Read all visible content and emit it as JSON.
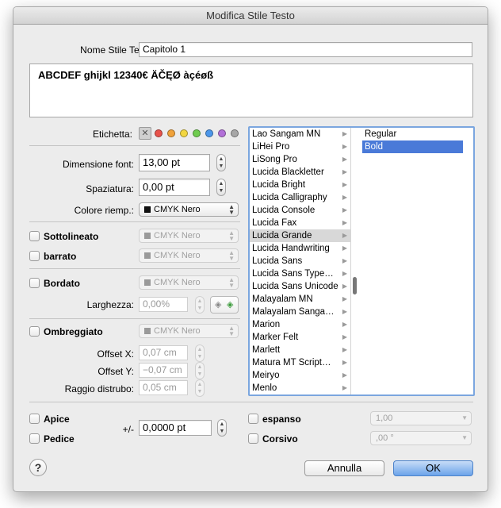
{
  "window": {
    "title": "Modifica Stile Testo"
  },
  "style_name": {
    "label": "Nome Stile Testo:",
    "value": "Capitolo 1"
  },
  "preview": {
    "text": "ABCDEF ghijkl 12340€ ÄČĘØ àçéøß"
  },
  "label_row": {
    "label": "Etichetta:",
    "none_symbol": "✕",
    "colors": [
      "#e8524b",
      "#f0a23a",
      "#f2d641",
      "#6fcc4f",
      "#4c97ea",
      "#b270d8",
      "#a7a7a7"
    ]
  },
  "font_size": {
    "label": "Dimensione font:",
    "value": "13,00 pt"
  },
  "spacing": {
    "label": "Spaziatura:",
    "value": "0,00 pt"
  },
  "fill_color": {
    "label": "Colore riemp.:",
    "value": "CMYK Nero"
  },
  "underline": {
    "label": "Sottolineato",
    "color": "CMYK Nero"
  },
  "strikethrough": {
    "label": "barrato",
    "color": "CMYK Nero"
  },
  "outline": {
    "label": "Bordato",
    "color": "CMYK Nero",
    "width_label": "Larghezza:",
    "width_value": "0,00%"
  },
  "shadow": {
    "label": "Ombreggiato",
    "color": "CMYK Nero",
    "offset_x_label": "Offset X:",
    "offset_x": "0,07 cm",
    "offset_y_label": "Offset Y:",
    "offset_y": "−0,07 cm",
    "blur_label": "Raggio distrubo:",
    "blur": "0,05 cm"
  },
  "fonts": {
    "families": [
      "Lao Sangam MN",
      "LiHei Pro",
      "LiSong Pro",
      "Lucida Blackletter",
      "Lucida Bright",
      "Lucida Calligraphy",
      "Lucida Console",
      "Lucida Fax",
      "Lucida Grande",
      "Lucida Handwriting",
      "Lucida Sans",
      "Lucida Sans Type…",
      "Lucida Sans Unicode",
      "Malayalam MN",
      "Malayalam Sanga…",
      "Marion",
      "Marker Felt",
      "Marlett",
      "Matura MT Script…",
      "Meiryo",
      "Menlo"
    ],
    "selected_family": "Lucida Grande",
    "styles": [
      "Regular",
      "Bold"
    ],
    "selected_style": "Bold"
  },
  "superscript": {
    "label": "Apice"
  },
  "subscript": {
    "label": "Pedice"
  },
  "baseline": {
    "label": "+/-",
    "value": "0,0000 pt"
  },
  "expanded": {
    "label": "espanso",
    "value": "1,00"
  },
  "italic": {
    "label": "Corsivo",
    "value": ",00 °"
  },
  "buttons": {
    "help": "?",
    "cancel": "Annulla",
    "ok": "OK"
  }
}
